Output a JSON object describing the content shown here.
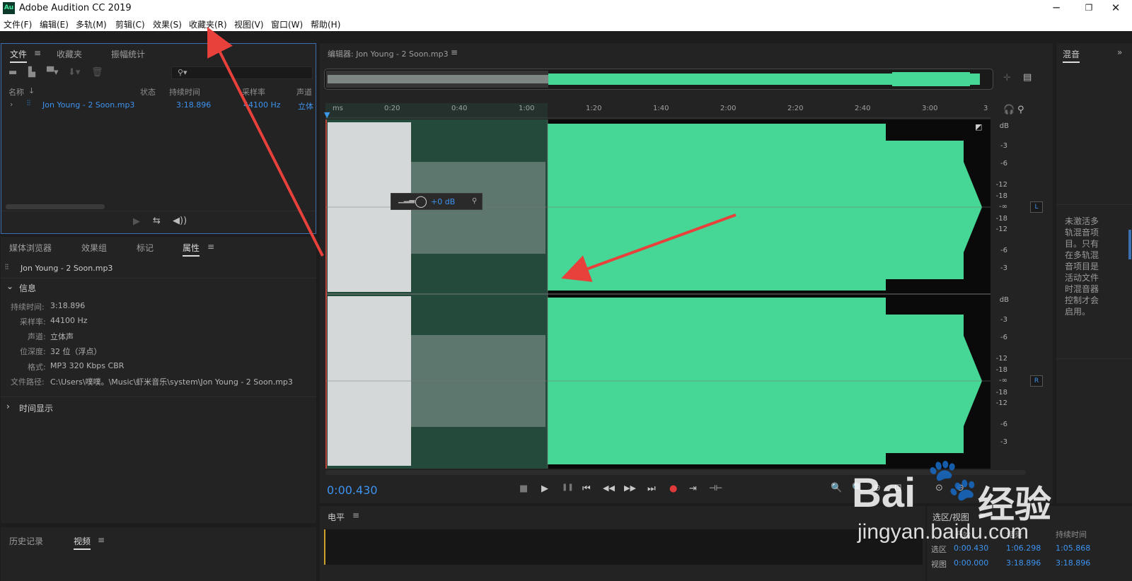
{
  "window": {
    "title": "Adobe Audition CC 2019",
    "app_icon": "Au",
    "min": "─",
    "max": "❐",
    "close": "✕"
  },
  "menu": [
    "文件(F)",
    "编辑(E)",
    "多轨(M)",
    "剪辑(C)",
    "效果(S)",
    "收藏夹(R)",
    "视图(V)",
    "窗口(W)",
    "帮助(H)"
  ],
  "files_panel": {
    "tabs": [
      "文件",
      "收藏夹",
      "振幅统计"
    ],
    "columns": {
      "name": "名称",
      "status": "状态",
      "duration": "持续时间",
      "samplerate": "采样率",
      "channels": "声道"
    },
    "file": {
      "name": "Jon Young - 2 Soon.mp3",
      "duration": "3:18.896",
      "samplerate": "44100 Hz",
      "channels": "立体"
    },
    "search_icon": "⚲▾"
  },
  "props_panel": {
    "tabs": [
      "媒体浏览器",
      "效果组",
      "标记",
      "属性"
    ],
    "file_name": "Jon Young - 2 Soon.mp3",
    "info_header": "信息",
    "info": [
      {
        "label": "持续时间:",
        "value": "3:18.896"
      },
      {
        "label": "采样率:",
        "value": "44100 Hz"
      },
      {
        "label": "声道:",
        "value": "立体声"
      },
      {
        "label": "位深度:",
        "value": "32 位（浮点）"
      },
      {
        "label": "格式:",
        "value": "MP3 320 Kbps CBR"
      },
      {
        "label": "文件路径:",
        "value": "C:\\Users\\噗噗。\\Music\\虾米音乐\\system\\Jon Young - 2 Soon.mp3"
      }
    ],
    "time_display": "时间显示"
  },
  "bottom_left": {
    "tabs": [
      "历史记录",
      "视频"
    ]
  },
  "editor": {
    "title": "编辑器: Jon Young - 2 Soon.mp3",
    "ruler": [
      "ms",
      "0:20",
      "0:40",
      "1:00",
      "1:20",
      "1:40",
      "2:00",
      "2:20",
      "2:40",
      "3:00",
      "3"
    ],
    "db_top": [
      "dB",
      "-3",
      "-6",
      "-12",
      "-18",
      "-∞",
      "-18",
      "-12",
      "-6",
      "-3"
    ],
    "db_bottom": [
      "dB",
      "-3",
      "-6",
      "-12",
      "-18",
      "-∞",
      "-18",
      "-12",
      "-6",
      "-3"
    ],
    "channel_l": "L",
    "channel_r": "R",
    "hud_gain": "+0 dB",
    "current_time": "0:00.430"
  },
  "transport": [
    "■",
    "▶",
    "❚❚",
    "⏮",
    "◀◀",
    "▶▶",
    "⏭",
    "●",
    "⇥",
    "⊣⊢"
  ],
  "level_panel": {
    "title": "电平"
  },
  "selection_panel": {
    "title": "选区/视图",
    "headers": [
      "开始",
      "结束",
      "持续时间"
    ],
    "rows": [
      {
        "label": "选区",
        "start": "0:00.430",
        "end": "1:06.298",
        "duration": "1:05.868"
      },
      {
        "label": "视图",
        "start": "0:00.000",
        "end": "3:18.896",
        "duration": "3:18.896"
      }
    ]
  },
  "mixer_panel": {
    "title": "混音",
    "message": "未激活多轨混音项目。只有在多轨混音项目是活动文件时混音器控制才会启用。"
  },
  "watermark": {
    "logo": "Bai",
    "paw": "🐾",
    "text": "经验",
    "url": "jingyan.baidu.com"
  },
  "colors": {
    "waveform": "#46d695",
    "selection": "#244a3c",
    "accent": "#3d93f0",
    "annotation_arrow": "#e8413b"
  }
}
